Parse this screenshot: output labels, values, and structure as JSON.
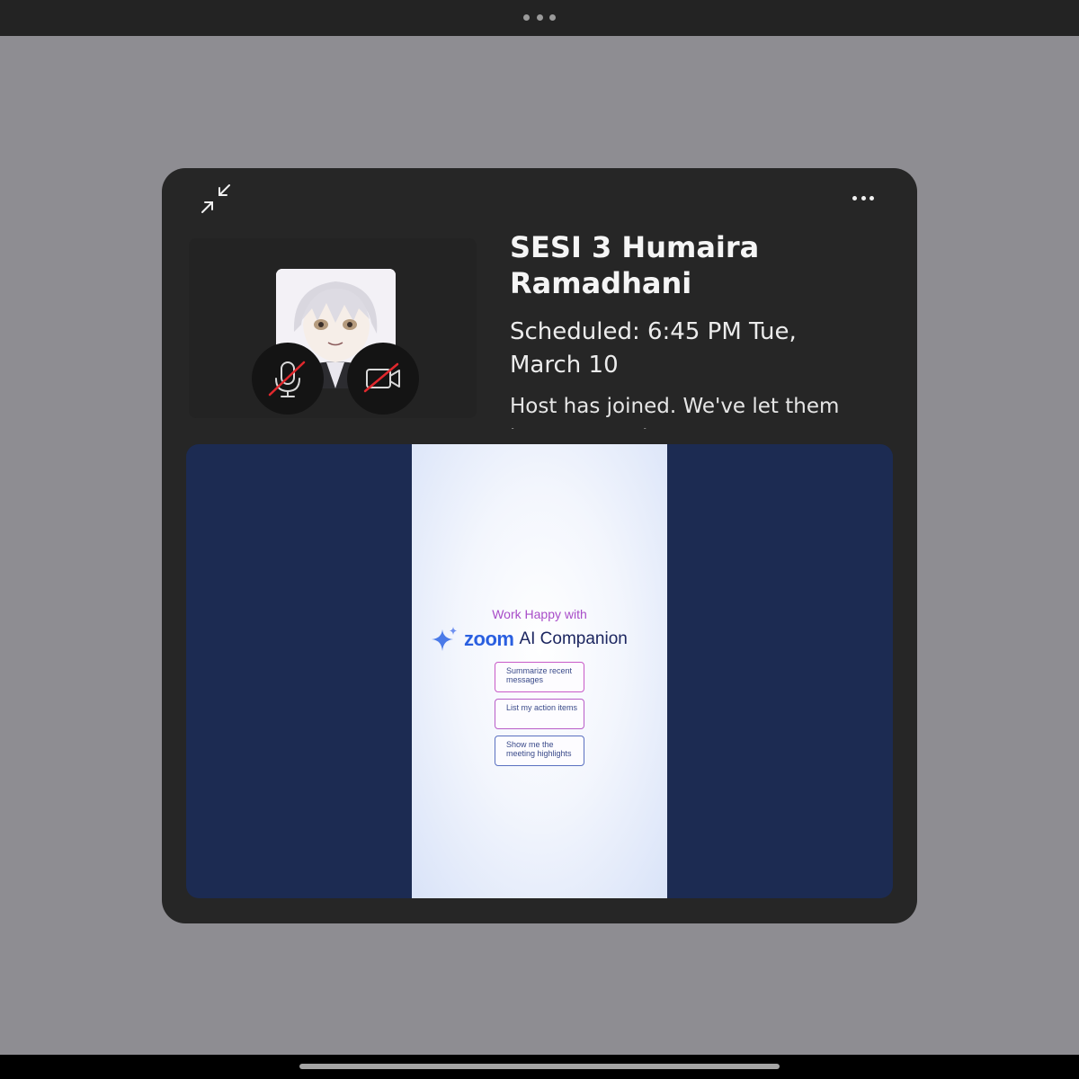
{
  "meeting": {
    "title": "SESI 3 Humaira Ramadhani",
    "scheduled": "Scheduled: 6:45 PM Tue, March 10",
    "status": "Host has joined. We've let them know you're here."
  },
  "icons": {
    "topbar": "more-dots-icon",
    "minimize": "minimize-arrows-icon",
    "more": "more-horizontal-icon",
    "mic": "mic-off-icon",
    "camera": "video-off-icon",
    "sparkle": "ai-sparkle-icon"
  },
  "colors": {
    "muted_slash": "#e0282d",
    "share_background": "#1c2b52",
    "zoom_blue": "#2a5fe0",
    "promo_purple": "#a84cc8"
  },
  "shared_content": {
    "headline": "Work Happy with",
    "brand_zoom": "zoom",
    "brand_product": "AI Companion",
    "chips": [
      {
        "label": "Summarize recent messages"
      },
      {
        "label": "List my action items"
      },
      {
        "label": "Show me the meeting highlights"
      }
    ]
  }
}
